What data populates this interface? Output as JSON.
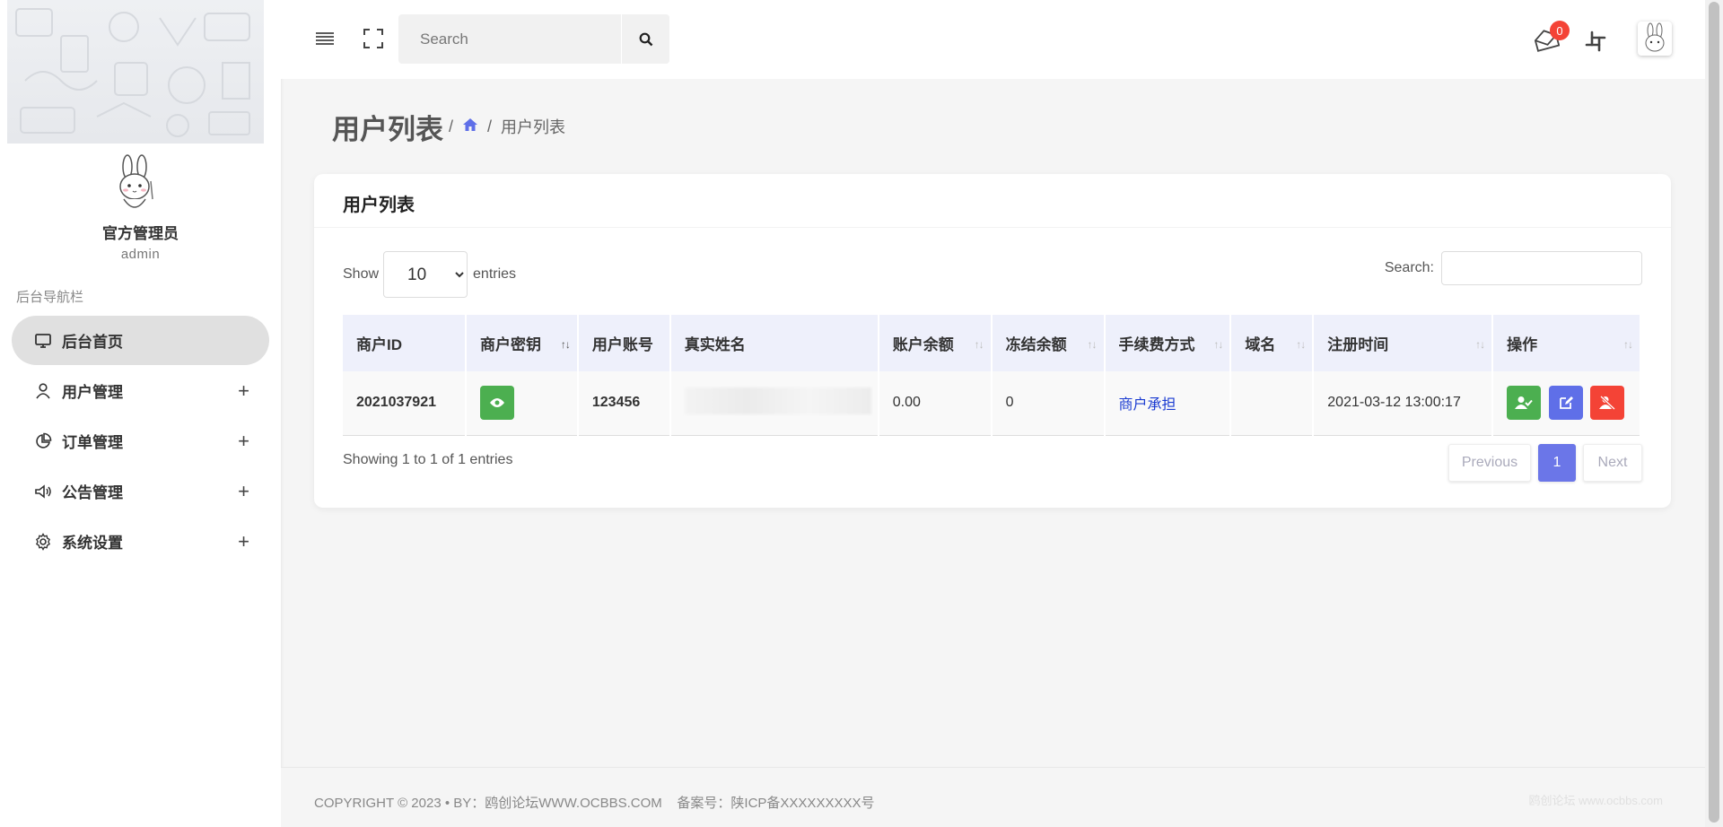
{
  "sidebar": {
    "admin_name": "官方管理员",
    "username": "admin",
    "nav_title": "后台导航栏",
    "items": [
      {
        "label": "后台首页",
        "icon": "monitor-icon",
        "active": true,
        "expandable": false
      },
      {
        "label": "用户管理",
        "icon": "user-icon",
        "active": false,
        "expandable": true
      },
      {
        "label": "订单管理",
        "icon": "pie-chart-icon",
        "active": false,
        "expandable": true
      },
      {
        "label": "公告管理",
        "icon": "speaker-icon",
        "active": false,
        "expandable": true
      },
      {
        "label": "系统设置",
        "icon": "gear-icon",
        "active": false,
        "expandable": true
      }
    ],
    "expand_symbol": "+"
  },
  "topbar": {
    "search_placeholder": "Search",
    "mail_badge": "0"
  },
  "page": {
    "title": "用户列表",
    "breadcrumb_sep": "/",
    "breadcrumb_current": "用户列表"
  },
  "card": {
    "title": "用户列表",
    "show_label": "Show",
    "entries_label": "entries",
    "page_length": "10",
    "search_label": "Search:",
    "columns": [
      "商户ID",
      "商户密钥",
      "用户账号",
      "真实姓名",
      "账户余额",
      "冻结余额",
      "手续费方式",
      "域名",
      "注册时间",
      "操作"
    ],
    "rows": [
      {
        "merchant_id": "2021037921",
        "account": "123456",
        "balance": "0.00",
        "frozen": "0",
        "fee_method": "商户承担",
        "domain": "",
        "registered": "2021-03-12 13:00:17"
      }
    ],
    "info": "Showing 1 to 1 of 1 entries",
    "pagination": {
      "previous": "Previous",
      "current": "1",
      "next": "Next"
    }
  },
  "footer": {
    "text": "COPYRIGHT © 2023 • BY：鸥创论坛WWW.OCBBS.COM    备案号：陕ICP备XXXXXXXXX号",
    "watermark": "鸥创论坛 www.ocbbs.com"
  },
  "colors": {
    "accent": "#6b76e8",
    "green": "#4caf50",
    "red": "#f44336",
    "link": "#1a3bd1"
  }
}
